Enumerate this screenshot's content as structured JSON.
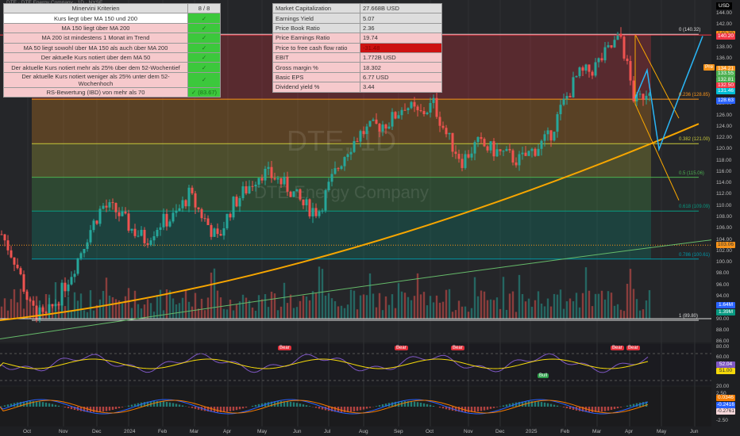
{
  "title": "DTE · DTE Energy Company · 1D · NYSE",
  "watermark": {
    "ticker": "DTE, 1D",
    "name": "DTE Energy Company"
  },
  "minervini": {
    "header": "Minervini Kriterien",
    "score": "8 / 8",
    "rows": [
      {
        "label": "Kurs liegt über MA 150 und 200",
        "value": "✓"
      },
      {
        "label": "MA 150 liegt über MA 200",
        "value": "✓"
      },
      {
        "label": "MA 200 ist mindestens 1 Monat im Trend",
        "value": "✓"
      },
      {
        "label": "MA 50 liegt sowohl über MA 150 als auch über MA 200",
        "value": "✓"
      },
      {
        "label": "Der aktuelle Kurs notiert über dem MA 50",
        "value": "✓"
      },
      {
        "label": "Der aktuelle Kurs notiert mehr als 25% über dem 52-Wochentief",
        "value": "✓"
      },
      {
        "label": "Der aktuelle Kurs notiert weniger als 25% unter dem 52-Wochenhoch",
        "value": "✓"
      },
      {
        "label": "RS-Bewertung (IBD) von mehr als 70",
        "value": "✓ (83.67)"
      }
    ]
  },
  "fundamentals": [
    {
      "label": "Market Capitalization",
      "value": "27.668B  USD"
    },
    {
      "label": "Earnings Yield",
      "value": "5.07"
    },
    {
      "label": "Price Book Ratio",
      "value": "2.36"
    },
    {
      "label": "Price Earnings Ratio",
      "value": "19.74"
    },
    {
      "label": "Price to free cash flow ratio",
      "value": "-31.48"
    },
    {
      "label": "EBIT",
      "value": "1.772B  USD"
    },
    {
      "label": "Gross margin %",
      "value": "18.302"
    },
    {
      "label": "Basic EPS",
      "value": "6.77  USD"
    },
    {
      "label": "Dividend yield %",
      "value": "3.44"
    }
  ],
  "price_axis": {
    "currency": "USD",
    "ticks": [
      "144.00",
      "142.00",
      "140.00",
      "138.00",
      "136.00",
      "134.00",
      "132.00",
      "130.00",
      "128.00",
      "126.00",
      "124.00",
      "122.00",
      "120.00",
      "118.00",
      "116.00",
      "114.00",
      "112.00",
      "110.00",
      "108.00",
      "106.00",
      "104.00",
      "102.00",
      "100.00",
      "98.00",
      "96.00",
      "94.00",
      "92.00",
      "90.00",
      "88.00",
      "86.00"
    ]
  },
  "price_tags": [
    {
      "text": "140.39",
      "price": 140.39,
      "bg": "#f7931a",
      "fg": "#333"
    },
    {
      "text": "140.20",
      "price": 139.9,
      "bg": "#f23645",
      "fg": "#fff"
    },
    {
      "text": "134.21",
      "price": 134.21,
      "bg": "#f7931a",
      "fg": "#fff"
    },
    {
      "text": "133.55",
      "price": 133.3,
      "bg": "#4caf50",
      "fg": "#fff"
    },
    {
      "text": "132.81",
      "price": 132.3,
      "bg": "#4caf50",
      "fg": "#fff"
    },
    {
      "text": "132.50",
      "price": 131.3,
      "bg": "#f23645",
      "fg": "#fff"
    },
    {
      "text": "131.46",
      "price": 130.3,
      "bg": "#00bcd4",
      "fg": "#fff"
    },
    {
      "text": "128.63",
      "price": 128.63,
      "bg": "#2962ff",
      "fg": "#fff"
    },
    {
      "text": "103.06",
      "price": 103.06,
      "bg": "#f7931a",
      "fg": "#333"
    },
    {
      "text": "1.64M",
      "price": 92.4,
      "bg": "#2962ff",
      "fg": "#fff"
    },
    {
      "text": "1.39M",
      "price": 91.2,
      "bg": "#089981",
      "fg": "#fff"
    }
  ],
  "pre_label": "Pre",
  "rsi": {
    "ticks": [
      "80.00",
      "60.00",
      "20.00"
    ],
    "tags": [
      "52.04",
      "51.00"
    ],
    "divergences": [
      {
        "t": "Bear",
        "x": 358
      },
      {
        "t": "Bear",
        "x": 505
      },
      {
        "t": "Bear",
        "x": 576
      },
      {
        "t": "Bull",
        "x": 685
      },
      {
        "t": "Bear",
        "x": 777
      },
      {
        "t": "Bear",
        "x": 797
      }
    ]
  },
  "macd": {
    "ticks": [
      "2.50",
      "-2.50"
    ],
    "tags": [
      "0.0346",
      "-0.2416",
      "-0.2761"
    ]
  },
  "time_axis": [
    "Oct",
    "Nov",
    "Dec",
    "2024",
    "Feb",
    "Mar",
    "Apr",
    "May",
    "Jun",
    "Jul",
    "Aug",
    "Sep",
    "Oct",
    "Nov",
    "Dec",
    "2025",
    "Feb",
    "Mar",
    "Apr",
    "May",
    "Jun"
  ],
  "chart_data": {
    "type": "candlestick",
    "title": "DTE Energy Company · 1D · NYSE",
    "ylim": [
      86,
      144
    ],
    "fib_levels": [
      {
        "ratio": "0",
        "price": 140.32
      },
      {
        "ratio": "0.236",
        "price": 128.85
      },
      {
        "ratio": "0.382",
        "price": 121.0
      },
      {
        "ratio": "0.5",
        "price": 115.06
      },
      {
        "ratio": "0.618",
        "price": 109.09
      },
      {
        "ratio": "0.786",
        "price": 100.61
      },
      {
        "ratio": "1",
        "price": 89.8
      }
    ],
    "approx_closes": [
      105,
      100,
      92,
      90,
      94,
      99,
      105,
      110,
      109,
      106,
      104,
      107,
      108,
      112,
      108,
      104,
      110,
      113,
      116,
      115,
      113,
      110,
      109,
      115,
      120,
      123,
      124,
      125,
      128,
      126,
      128,
      122,
      118,
      121,
      120,
      119,
      118,
      120,
      122,
      128,
      133,
      134,
      137,
      140,
      128,
      131
    ]
  }
}
